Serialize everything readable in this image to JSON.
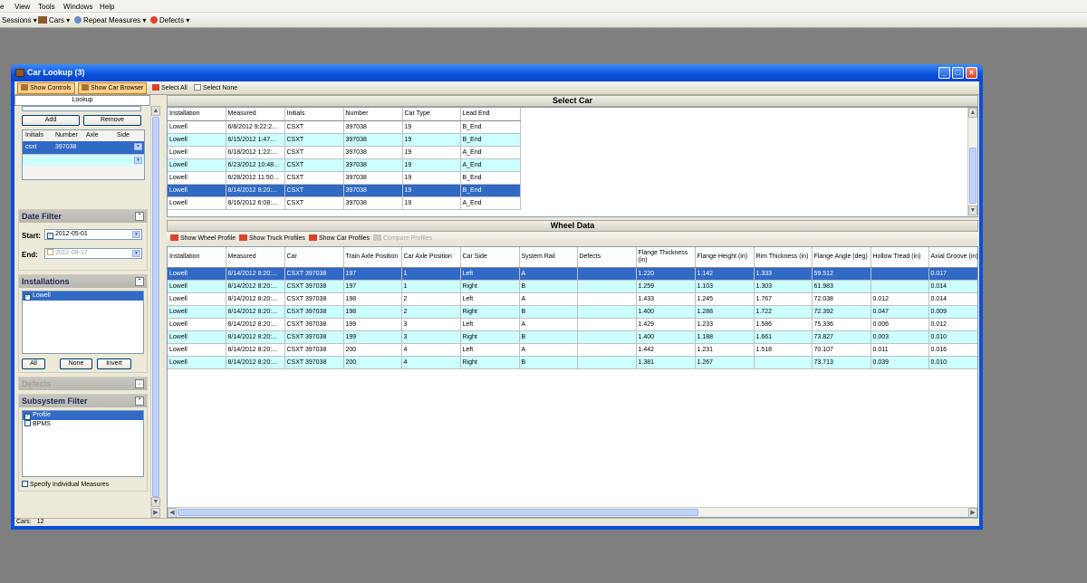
{
  "menu": {
    "items": [
      "e",
      "View",
      "Tools",
      "Windows",
      "Help"
    ]
  },
  "toolbar": {
    "sessions": "Sessions",
    "cars": "Cars",
    "repeat": "Repeat Measures",
    "defects": "Defects"
  },
  "window": {
    "title": "Car Lookup (3)"
  },
  "client_toolbar": {
    "show_controls": "Show Controls",
    "show_car_browser": "Show Car Browser",
    "select_all": "Select All",
    "select_none": "Select None"
  },
  "left": {
    "lookup_tab": "Lookup",
    "add": "Add",
    "remove": "Remove",
    "car_grid": {
      "headers": [
        "Initials",
        "Number",
        "Axle",
        "Side"
      ],
      "row": {
        "initials": "csxt",
        "number": "397038",
        "axle": "",
        "side": ""
      }
    },
    "date_filter": {
      "title": "Date Filter",
      "start_label": "Start:",
      "start_value": "2012-05-01",
      "end_label": "End:",
      "end_value": "2012-08-17"
    },
    "installations": {
      "title": "Installations",
      "items": [
        "Lowell"
      ],
      "all": "All",
      "none": "None",
      "invert": "Invert"
    },
    "defects": {
      "title": "Defects"
    },
    "subsystem": {
      "title": "Subsystem Filter",
      "items": [
        "Profile",
        "BPMS"
      ],
      "individual": "Specify Individual Measures"
    }
  },
  "select_car": {
    "title": "Select Car",
    "headers": [
      "Installation",
      "Measured",
      "Initials",
      "Number",
      "Car Type",
      "Lead End"
    ],
    "rows": [
      [
        "Lowell",
        "6/8/2012 9:22:2...",
        "CSXT",
        "397038",
        "19",
        "B_End"
      ],
      [
        "Lowell",
        "6/15/2012 1:47...",
        "CSXT",
        "397038",
        "19",
        "B_End"
      ],
      [
        "Lowell",
        "6/18/2012 1:22:...",
        "CSXT",
        "397038",
        "19",
        "A_End"
      ],
      [
        "Lowell",
        "6/23/2012 10:48...",
        "CSXT",
        "397038",
        "19",
        "A_End"
      ],
      [
        "Lowell",
        "6/28/2012 11:50...",
        "CSXT",
        "397038",
        "19",
        "B_End"
      ],
      [
        "Lowell",
        "8/14/2012 8:20:...",
        "CSXT",
        "397038",
        "19",
        "B_End"
      ],
      [
        "Lowell",
        "8/16/2012 6:08:...",
        "CSXT",
        "397038",
        "19",
        "A_End"
      ]
    ],
    "selected_index": 5
  },
  "wheel_data": {
    "title": "Wheel Data",
    "tools": {
      "show_wheel_profile": "Show Wheel Profile",
      "show_truck_profiles": "Show Truck Profiles",
      "show_car_profiles": "Show Car Profiles",
      "compare_profiles": "Compare Profiles"
    },
    "headers": [
      "Installation",
      "Measured",
      "Car",
      "Train Axle Position",
      "Car Axle Position",
      "Car Side",
      "System Rail",
      "Defects",
      "Flange Thickness (in)",
      "Flange Height (in)",
      "Rim Thickness (in)",
      "Flange Angle (deg)",
      "Hollow Tread (in)",
      "Axial Groove (in)"
    ],
    "rows": [
      [
        "Lowell",
        "8/14/2012 8:20:...",
        "CSXT 397038",
        "197",
        "1",
        "Left",
        "A",
        "",
        "1.220",
        "1.142",
        "1.333",
        "59.512",
        "",
        "0.017"
      ],
      [
        "Lowell",
        "8/14/2012 8:20:...",
        "CSXT 397038",
        "197",
        "1",
        "Right",
        "B",
        "",
        "1.259",
        "1.103",
        "1.303",
        "61.983",
        "",
        "0.014"
      ],
      [
        "Lowell",
        "8/14/2012 8:20:...",
        "CSXT 397038",
        "198",
        "2",
        "Left",
        "A",
        "",
        "1.433",
        "1.245",
        "1.767",
        "72.038",
        "0.012",
        "0.014"
      ],
      [
        "Lowell",
        "8/14/2012 8:20:...",
        "CSXT 397038",
        "198",
        "2",
        "Right",
        "B",
        "",
        "1.400",
        "1.288",
        "1.722",
        "72.392",
        "0.047",
        "0.009"
      ],
      [
        "Lowell",
        "8/14/2012 8:20:...",
        "CSXT 397038",
        "199",
        "3",
        "Left",
        "A",
        "",
        "1.429",
        "1.233",
        "1.586",
        "75.336",
        "0.006",
        "0.012"
      ],
      [
        "Lowell",
        "8/14/2012 8:20:...",
        "CSXT 397038",
        "199",
        "3",
        "Right",
        "B",
        "",
        "1.400",
        "1.188",
        "1.661",
        "73.827",
        "0.003",
        "0.010"
      ],
      [
        "Lowell",
        "8/14/2012 8:20:...",
        "CSXT 397038",
        "200",
        "4",
        "Left",
        "A",
        "",
        "1.442",
        "1.231",
        "1.518",
        "70.107",
        "0.011",
        "0.016"
      ],
      [
        "Lowell",
        "8/14/2012 8:20:...",
        "CSXT 397038",
        "200",
        "4",
        "Right",
        "B",
        "",
        "1.381",
        "1.267",
        "",
        "73.713",
        "0.039",
        "0.010"
      ]
    ],
    "selected_index": 0
  },
  "status": {
    "label": "Cars:",
    "count": "12"
  }
}
